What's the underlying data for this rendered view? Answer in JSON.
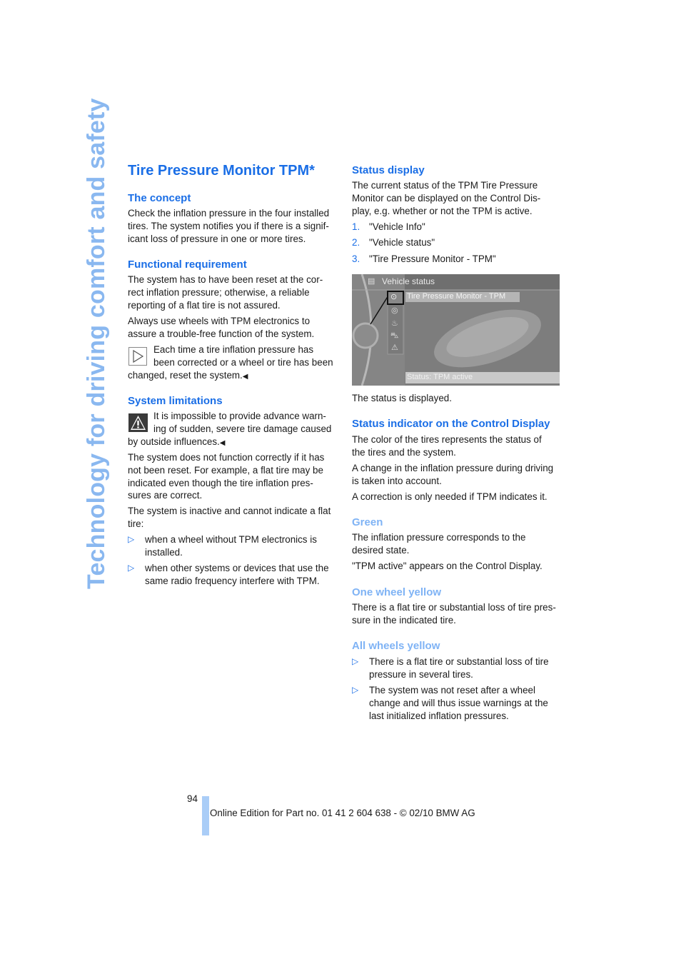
{
  "side_title": "Technology for driving comfort and safety",
  "left": {
    "title": "Tire Pressure Monitor TPM*",
    "concept": {
      "heading": "The concept",
      "lines": [
        "Check the inflation pressure in the four installed",
        "tires. The system notifies you if there is a signif-",
        "icant loss of pressure in one or more tires."
      ]
    },
    "functional": {
      "heading": "Functional requirement",
      "para1": [
        "The system has to have been reset at the cor-",
        "rect inflation pressure; otherwise, a reliable",
        "reporting of a flat tire is not assured."
      ],
      "para2": [
        "Always use wheels with TPM electronics to",
        "assure a trouble-free function of the system."
      ],
      "note": [
        "Each time a tire inflation pressure has",
        "been corrected or a wheel or tire has been",
        "changed, reset the system."
      ],
      "note_icon": "note-triangle-icon"
    },
    "limitations": {
      "heading": "System limitations",
      "warning": [
        "It is impossible to provide advance warn-",
        "ing of sudden, severe tire damage caused",
        "by outside influences."
      ],
      "warning_icon": "warning-icon",
      "para1": [
        "The system does not function correctly if it has",
        "not been reset. For example, a flat tire may be",
        "indicated even though the tire inflation pres-",
        "sures are correct."
      ],
      "para2": [
        "The system is inactive and cannot indicate a flat",
        "tire:"
      ],
      "bullets": [
        [
          "when a wheel without TPM electronics is",
          "installed."
        ],
        [
          "when other systems or devices that use the",
          "same radio frequency interfere with TPM."
        ]
      ]
    }
  },
  "right": {
    "status_display": {
      "heading": "Status display",
      "lines": [
        "The current status of the TPM Tire Pressure",
        "Monitor can be displayed on the Control Dis-",
        "play, e.g. whether or not the TPM is active."
      ],
      "steps": [
        {
          "num": "1.",
          "text": "\"Vehicle Info\""
        },
        {
          "num": "2.",
          "text": "\"Vehicle status\""
        },
        {
          "num": "3.",
          "text": "\"Tire Pressure Monitor - TPM\""
        }
      ]
    },
    "screen": {
      "header": "Vehicle status",
      "selected_item": "Tire Pressure Monitor - TPM",
      "status": "Status: TPM active",
      "menu_icons": [
        "tire-pressure-icon",
        "tire-icon",
        "oil-icon",
        "car-icon",
        "warning-icon"
      ]
    },
    "status_caption": "The status is displayed.",
    "indicator": {
      "heading": "Status indicator on the Control Display",
      "para1": [
        "The color of the tires represents the status of",
        "the tires and the system."
      ],
      "para2": [
        "A change in the inflation pressure during driving",
        "is taken into account."
      ],
      "para3": [
        "A correction is only needed if TPM indicates it."
      ]
    },
    "green": {
      "heading": "Green",
      "para1": [
        "The inflation pressure corresponds to the",
        "desired state."
      ],
      "para2": [
        "\"TPM active\" appears on the Control Display."
      ]
    },
    "one_wheel": {
      "heading": "One wheel yellow",
      "para": [
        "There is a flat tire or substantial loss of tire pres-",
        "sure in the indicated tire."
      ]
    },
    "all_wheels": {
      "heading": "All wheels yellow",
      "bullets": [
        [
          "There is a flat tire or substantial loss of tire",
          "pressure in several tires."
        ],
        [
          "The system was not reset after a wheel",
          "change and will thus issue warnings at the",
          "last initialized inflation pressures."
        ]
      ]
    }
  },
  "footer": {
    "page_number": "94",
    "text": "Online Edition for Part no. 01 41 2 604 638 - © 02/10 BMW AG"
  },
  "colors": {
    "heading_blue": "#1a6ee6",
    "subheading_light_blue": "#7fb3f5",
    "side_title": "#8ab8f0",
    "footer_bar": "#aacdf7"
  }
}
